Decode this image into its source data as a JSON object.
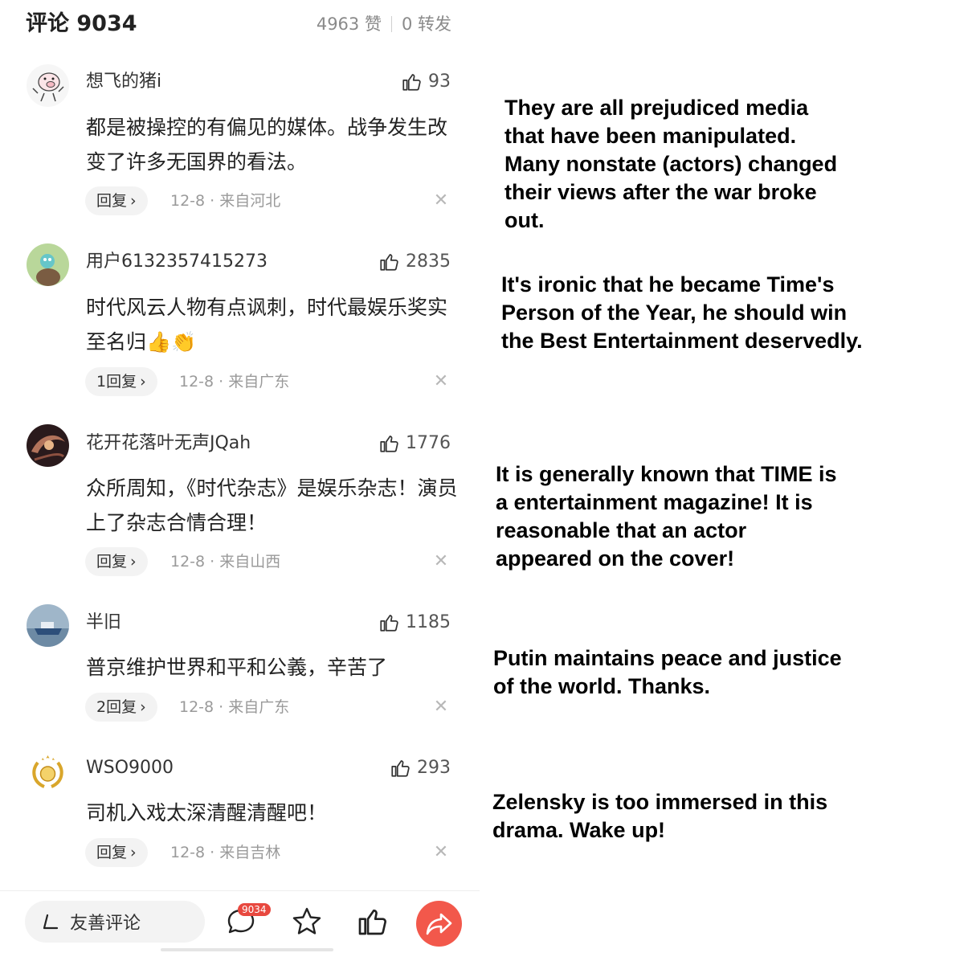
{
  "header": {
    "title": "评论 9034",
    "likes": "4963 赞",
    "reposts": "0 转发"
  },
  "comments": [
    {
      "username": "想飞的猪i",
      "likes": "93",
      "text": "都是被操控的有偏见的媒体。战争发生改变了许多无国界的看法。",
      "reply_label": "回复",
      "meta": "12-8 · 来自河北",
      "translation": "They are all prejudiced media\nthat have been manipulated.\nMany nonstate (actors) changed\ntheir views after the war broke\nout."
    },
    {
      "username": "用户6132357415273",
      "likes": "2835",
      "text": "时代风云人物有点讽刺，时代最娱乐奖实至名归👍👏",
      "reply_label": "1回复",
      "meta": "12-8 · 来自广东",
      "translation": "It's ironic that he became Time's\nPerson of the Year, he should win\nthe Best Entertainment deservedly."
    },
    {
      "username": "花开花落叶无声JQah",
      "likes": "1776",
      "text": "众所周知，《时代杂志》是娱乐杂志！演员上了杂志合情合理！",
      "reply_label": "回复",
      "meta": "12-8 · 来自山西",
      "translation": "It is generally known that TIME is\na entertainment magazine! It is\nreasonable that an actor\nappeared on the cover!"
    },
    {
      "username": "半旧",
      "likes": "1185",
      "text": "普京维护世界和平和公義，辛苦了",
      "reply_label": "2回复",
      "meta": "12-8 · 来自广东",
      "translation": "Putin maintains peace and justice\nof the world. Thanks."
    },
    {
      "username": "WSO9000",
      "likes": "293",
      "text": "司机入戏太深清醒清醒吧！",
      "reply_label": "回复",
      "meta": "12-8 · 来自吉林",
      "translation": "Zelensky is too immersed in this\ndrama. Wake up!"
    }
  ],
  "bottombar": {
    "compose_placeholder": "友善评论",
    "comment_badge": "9034"
  },
  "icons": {
    "like": "thumbs-up-icon",
    "close": "close-icon",
    "chevron": "chevron-right-icon",
    "pen": "pen-icon",
    "comment": "comment-bubble-icon",
    "star": "star-icon",
    "share": "share-arrow-icon"
  },
  "colors": {
    "accent": "#f2584b",
    "badge": "#e8483f",
    "muted": "#9a9a9a"
  }
}
